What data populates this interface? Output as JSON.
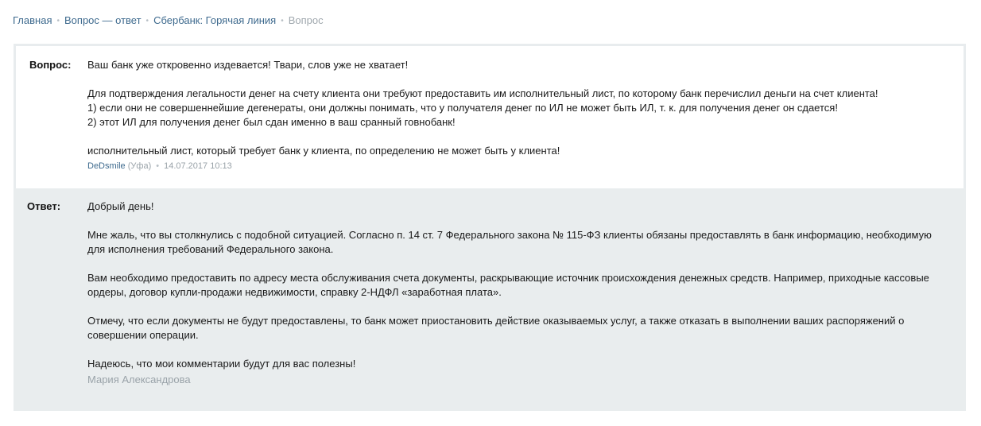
{
  "breadcrumb": {
    "items": [
      {
        "label": "Главная"
      },
      {
        "label": "Вопрос — ответ"
      },
      {
        "label": "Сбербанк: Горячая линия"
      }
    ],
    "current": "Вопрос"
  },
  "question": {
    "label": "Вопрос:",
    "paragraphs": [
      "Ваш банк уже откровенно издевается! Твари, слов уже не хватает!",
      "Для подтверждения легальности денег на счету клиента они требуют предоставить им исполнительный лист, по которому банк перечислил деньги на счет клиента!",
      "1) если они не совершеннейшие дегенераты, они должны понимать, что у получателя денег по ИЛ не может быть ИЛ, т. к. для получения денег он сдается!",
      "2) этот ИЛ для получения денег был сдан именно в ваш сранный говнобанк!",
      "исполнительный лист, который требует банк у клиента, по определению не может быть у клиента!"
    ],
    "author": "DeDsmile",
    "city": "(Уфа)",
    "date": "14.07.2017 10:13"
  },
  "answer": {
    "label": "Ответ:",
    "paragraphs": [
      "Добрый день!",
      "Мне жаль, что вы столкнулись с подобной ситуацией. Согласно п. 14 ст. 7 Федерального закона № 115-ФЗ клиенты обязаны предоставлять в банк информацию, необходимую для исполнения требований Федерального закона.",
      "Вам необходимо предоставить по адресу места обслуживания счета документы, раскрывающие источник происхождения денежных средств. Например, приходные кассовые ордеры, договор купли-продажи недвижимости, справку 2-НДФЛ «заработная плата».",
      "Отмечу, что если документы не будут предоставлены, то банк может приостановить действие оказываемых услуг, а также отказать в выполнении ваших распоряжений о совершении операции.",
      "Надеюсь, что мои комментарии будут для вас полезны!"
    ],
    "signature": "Мария Александрова"
  }
}
